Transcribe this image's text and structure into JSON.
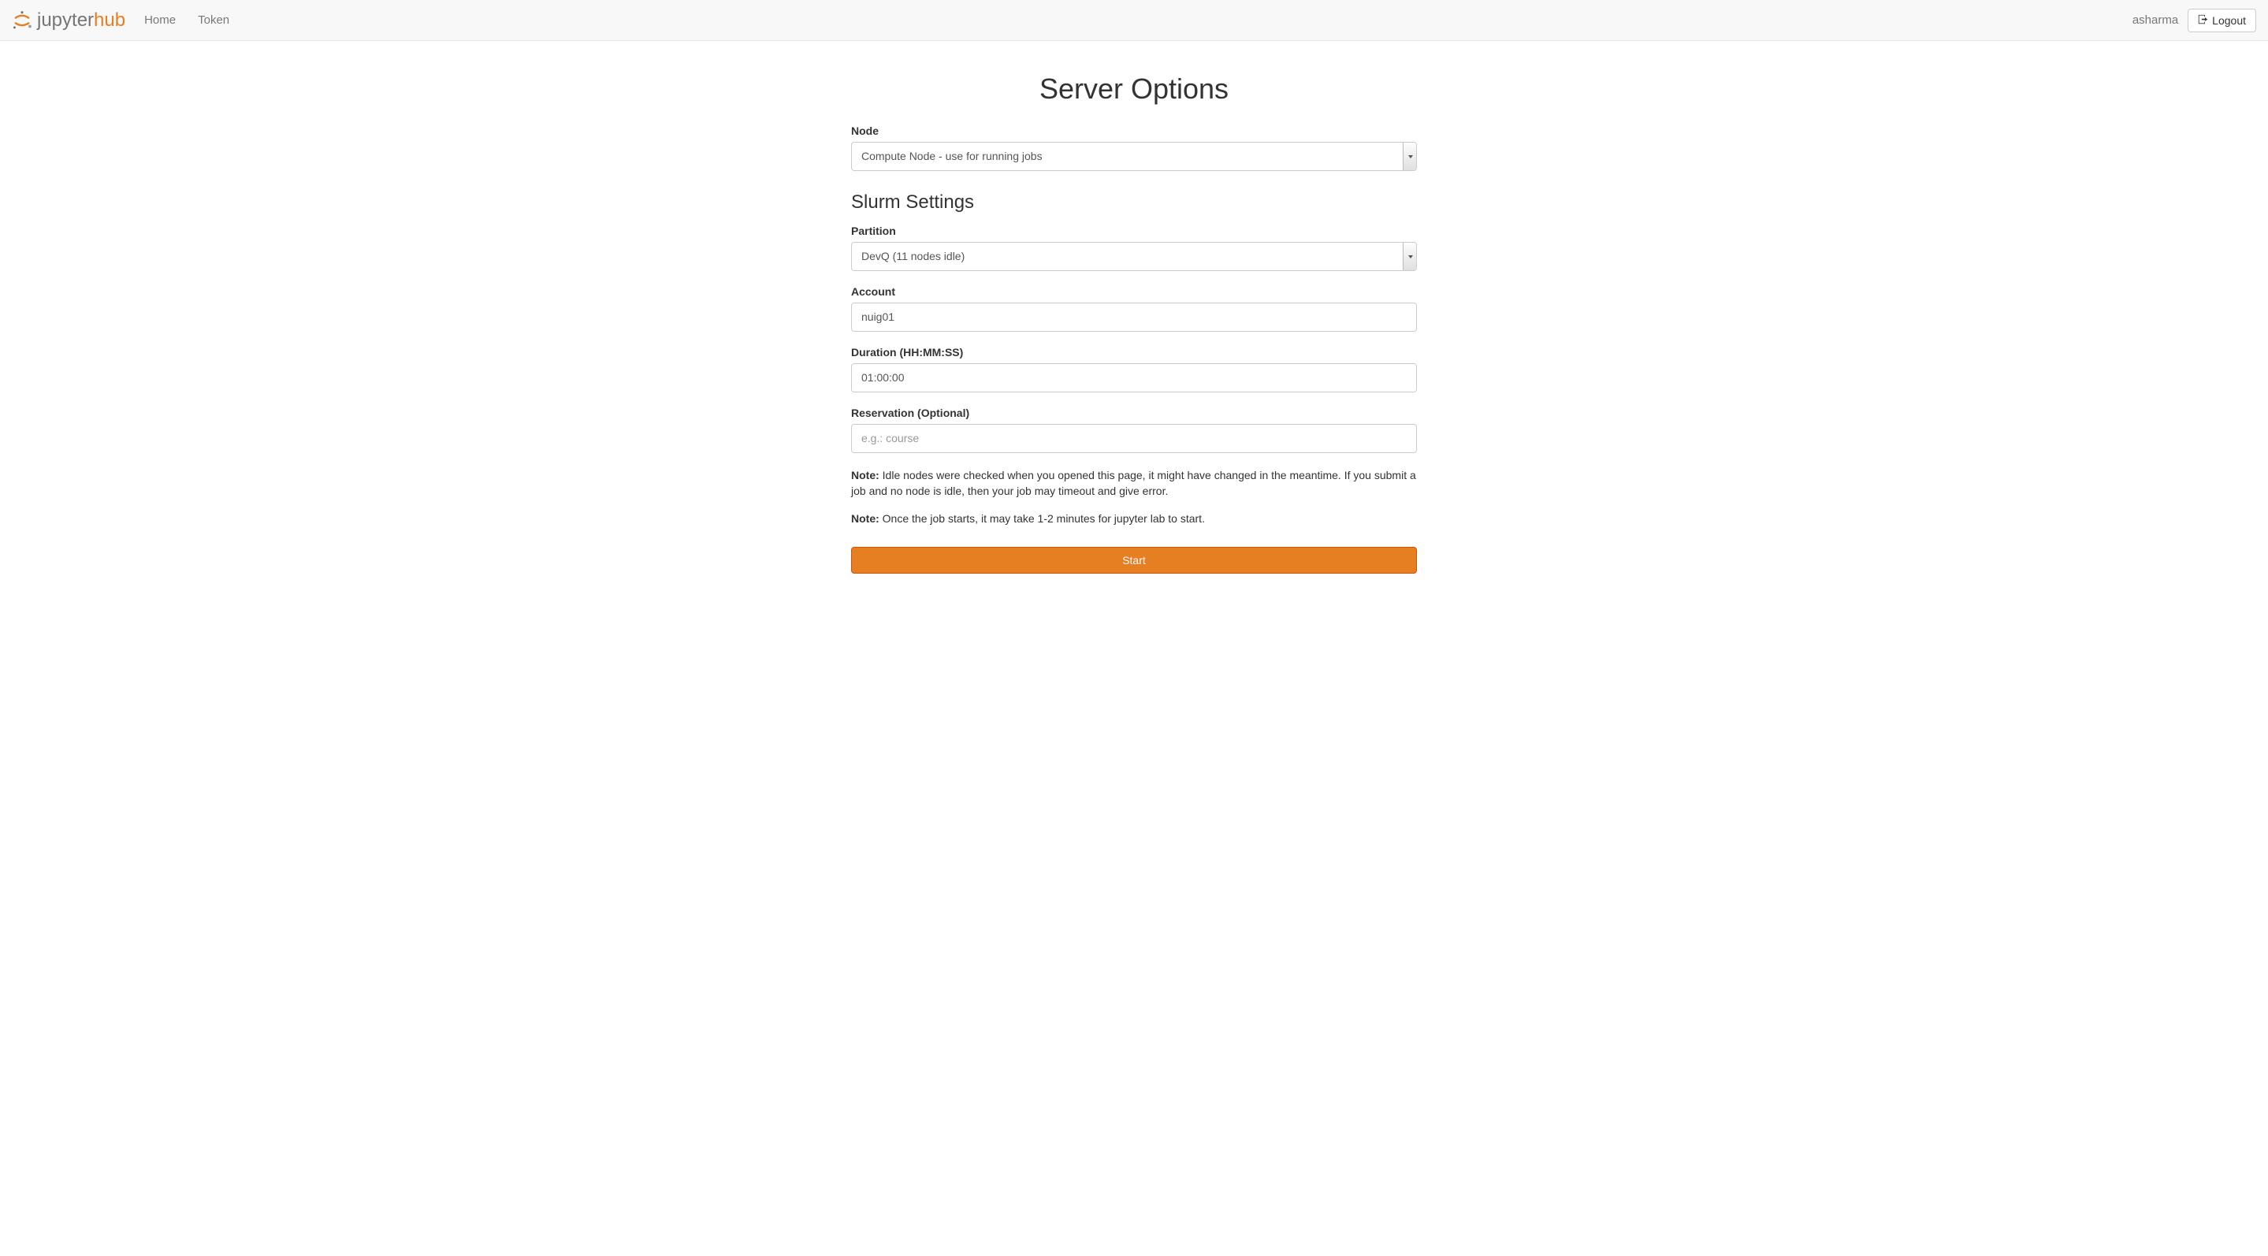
{
  "navbar": {
    "brand_jupyter": "jupyter",
    "brand_hub": "hub",
    "home_label": "Home",
    "token_label": "Token",
    "username": "asharma",
    "logout_label": "Logout"
  },
  "page": {
    "title": "Server Options"
  },
  "form": {
    "node_label": "Node",
    "node_value": "Compute Node - use for running jobs",
    "slurm_heading": "Slurm Settings",
    "partition_label": "Partition",
    "partition_value": "DevQ (11 nodes idle)",
    "account_label": "Account",
    "account_value": "nuig01",
    "duration_label": "Duration (HH:MM:SS)",
    "duration_value": "01:00:00",
    "reservation_label": "Reservation (Optional)",
    "reservation_placeholder": "e.g.: course",
    "reservation_value": ""
  },
  "notes": {
    "note1_prefix": "Note:",
    "note1_text": " Idle nodes were checked when you opened this page, it might have changed in the meantime. If you submit a job and no node is idle, then your job may timeout and give error.",
    "note2_prefix": "Note:",
    "note2_text": " Once the job starts, it may take 1-2 minutes for jupyter lab to start."
  },
  "actions": {
    "start_label": "Start"
  }
}
